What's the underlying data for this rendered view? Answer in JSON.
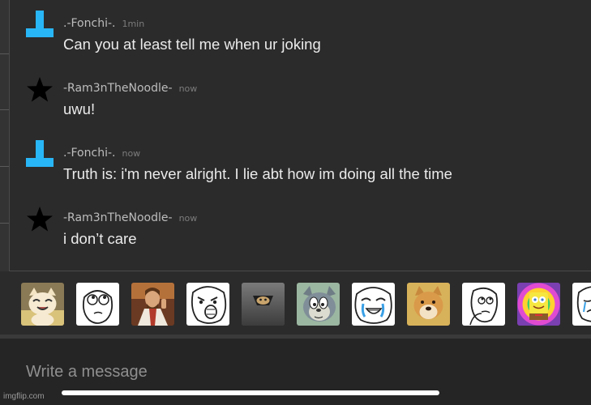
{
  "messages": [
    {
      "user": ".-Fonchi-.",
      "time": "1min",
      "text": "Can you at least tell me when ur joking",
      "avatar_icon": "tetromino-t-icon",
      "avatar_color": "#29b6f6"
    },
    {
      "user": "-Ram3nTheNoodle-",
      "time": "now",
      "text": "uwu!",
      "avatar_icon": "star-icon",
      "avatar_color": "#000000"
    },
    {
      "user": ".-Fonchi-.",
      "time": "now",
      "text": "Truth is: i'm never alright. I lie abt how im doing all the time",
      "avatar_icon": "tetromino-t-icon",
      "avatar_color": "#29b6f6"
    },
    {
      "user": "-Ram3nTheNoodle-",
      "time": "now",
      "text": "i don’t care",
      "avatar_icon": "star-icon",
      "avatar_color": "#000000"
    }
  ],
  "stickers": [
    {
      "icon": "happy-cat-sticker-icon"
    },
    {
      "icon": "rage-face-rolling-eyes-sticker-icon"
    },
    {
      "icon": "buddy-jesus-sticker-icon"
    },
    {
      "icon": "lol-face-sticker-icon"
    },
    {
      "icon": "ceiling-cat-sticker-icon"
    },
    {
      "icon": "tom-cat-meme-sticker-icon"
    },
    {
      "icon": "happy-tears-face-sticker-icon"
    },
    {
      "icon": "doge-sticker-icon"
    },
    {
      "icon": "thinking-face-sticker-icon"
    },
    {
      "icon": "imagination-spongebob-sticker-icon"
    },
    {
      "icon": "forever-alone-face-sticker-icon"
    }
  ],
  "composer": {
    "placeholder": "Write a message",
    "value": ""
  },
  "watermark": "imgflip.com",
  "colors": {
    "background": "#2b2b2b",
    "composer": "#252525",
    "accent": "#29b6f6"
  }
}
